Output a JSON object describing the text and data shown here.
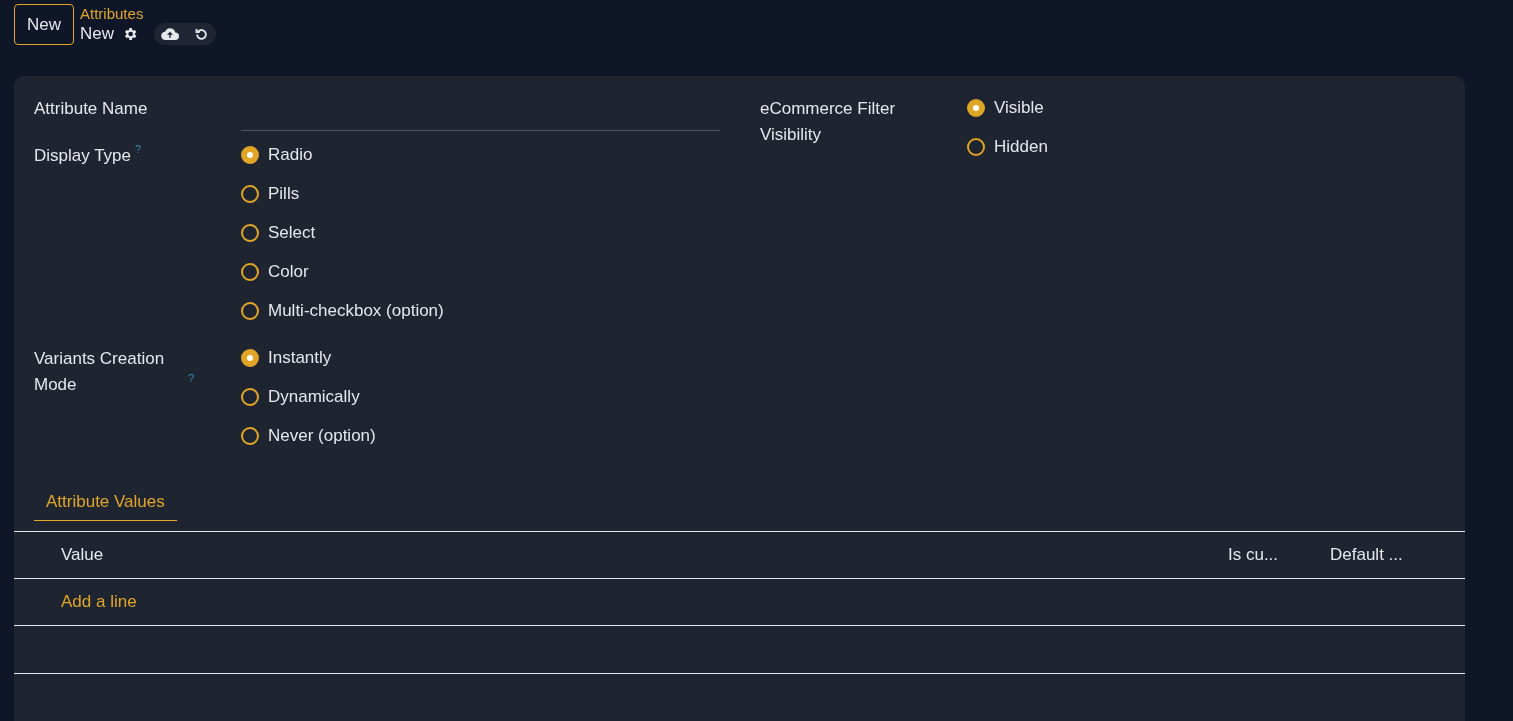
{
  "header": {
    "new_button": "New",
    "breadcrumb": "Attributes",
    "record_title": "New"
  },
  "left_fields": [
    {
      "kind": "text",
      "label": "Attribute Name"
    },
    {
      "kind": "radio",
      "label": "Display Type",
      "help": "?",
      "options": [
        {
          "label": "Radio",
          "selected": true
        },
        {
          "label": "Pills",
          "selected": false
        },
        {
          "label": "Select",
          "selected": false
        },
        {
          "label": "Color",
          "selected": false
        },
        {
          "label": "Multi-checkbox (option)",
          "selected": false
        }
      ]
    },
    {
      "kind": "radio",
      "label": "Variants Creation Mode",
      "help": "?",
      "options": [
        {
          "label": "Instantly",
          "selected": true
        },
        {
          "label": "Dynamically",
          "selected": false
        },
        {
          "label": "Never (option)",
          "selected": false
        }
      ]
    }
  ],
  "right_fields": [
    {
      "kind": "radio",
      "label": "eCommerce Filter Visibility",
      "options": [
        {
          "label": "Visible",
          "selected": true
        },
        {
          "label": "Hidden",
          "selected": false
        }
      ]
    }
  ],
  "tabs": [
    {
      "label": "Attribute Values",
      "selected": true
    }
  ],
  "table": {
    "columns": [
      "Value",
      "Is cu...",
      "Default ..."
    ],
    "add_line": "Add a line"
  }
}
